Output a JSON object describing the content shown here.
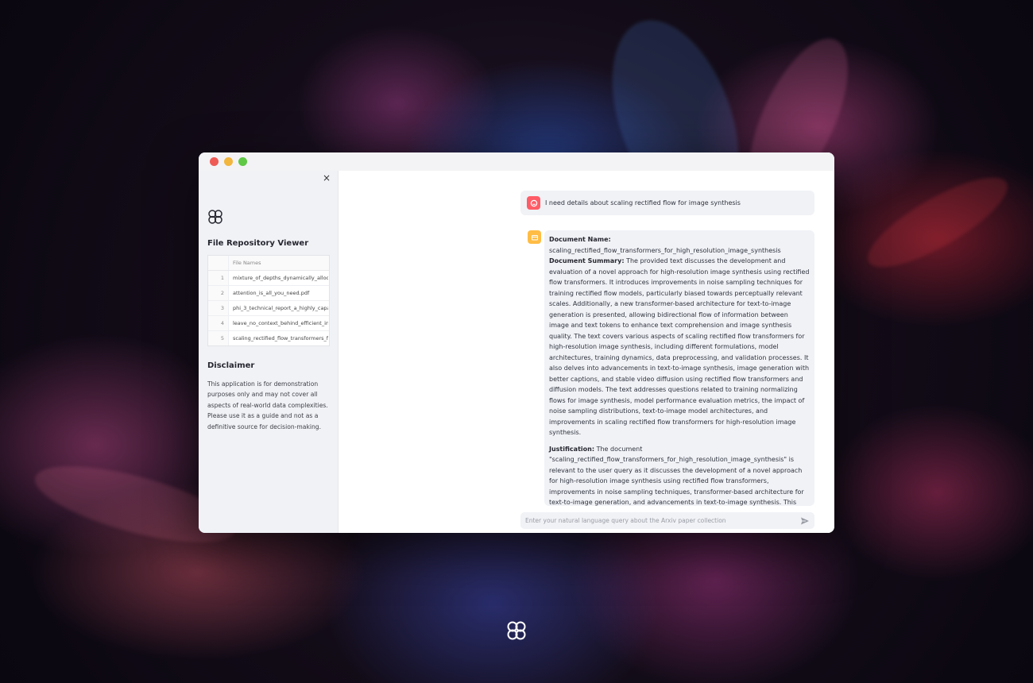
{
  "sidebar": {
    "close_label": "×",
    "title": "File Repository Viewer",
    "table": {
      "header": "File Names",
      "rows": [
        {
          "index": "1",
          "name": "mixture_of_depths_dynamically_alloca"
        },
        {
          "index": "2",
          "name": "attention_is_all_you_need.pdf"
        },
        {
          "index": "3",
          "name": "phi_3_technical_report_a_highly_capa"
        },
        {
          "index": "4",
          "name": "leave_no_context_behind_efficient_inf"
        },
        {
          "index": "5",
          "name": "scaling_rectified_flow_transformers_fo"
        }
      ]
    },
    "disclaimer_title": "Disclaimer",
    "disclaimer_text": "This application is for demonstration purposes only and may not cover all aspects of real-world data complexities. Please use it as a guide and not as a definitive source for decision-making."
  },
  "chat": {
    "user_message": "I need details about scaling rectified flow for image synthesis",
    "bot": {
      "doc_name_label": "Document Name:",
      "doc_name": "scaling_rectified_flow_transformers_for_high_resolution_image_synthesis",
      "summary_label": "Document Summary:",
      "summary": "The provided text discusses the development and evaluation of a novel approach for high-resolution image synthesis using rectified flow transformers. It introduces improvements in noise sampling techniques for training rectified flow models, particularly biased towards perceptually relevant scales. Additionally, a new transformer-based architecture for text-to-image generation is presented, allowing bidirectional flow of information between image and text tokens to enhance text comprehension and image synthesis quality. The text covers various aspects of scaling rectified flow transformers for high-resolution image synthesis, including different formulations, model architectures, training dynamics, data preprocessing, and validation processes. It also delves into advancements in text-to-image synthesis, image generation with better captions, and stable video diffusion using rectified flow transformers and diffusion models. The text addresses questions related to training normalizing flows for image synthesis, model performance evaluation metrics, the impact of noise sampling distributions, text-to-image model architectures, and improvements in scaling rectified flow transformers for high-resolution image synthesis.",
      "justification_label": "Justification:",
      "justification": "The document \"scaling_rectified_flow_transformers_for_high_resolution_image_synthesis\" is relevant to the user query as it discusses the development of a novel approach for high-resolution image synthesis using rectified flow transformers, improvements in noise sampling techniques, transformer-based architecture for text-to-image generation, and advancements in text-to-image synthesis. This"
    },
    "input_placeholder": "Enter your natural language query about the Arxiv paper collection"
  },
  "colors": {
    "user_avatar": "#ff5c67",
    "bot_avatar": "#ffbd45",
    "sidebar_bg": "#f0f2f6"
  },
  "icons": [
    "app-logo-icon",
    "close-icon",
    "user-avatar-icon",
    "bot-avatar-icon",
    "send-icon"
  ]
}
